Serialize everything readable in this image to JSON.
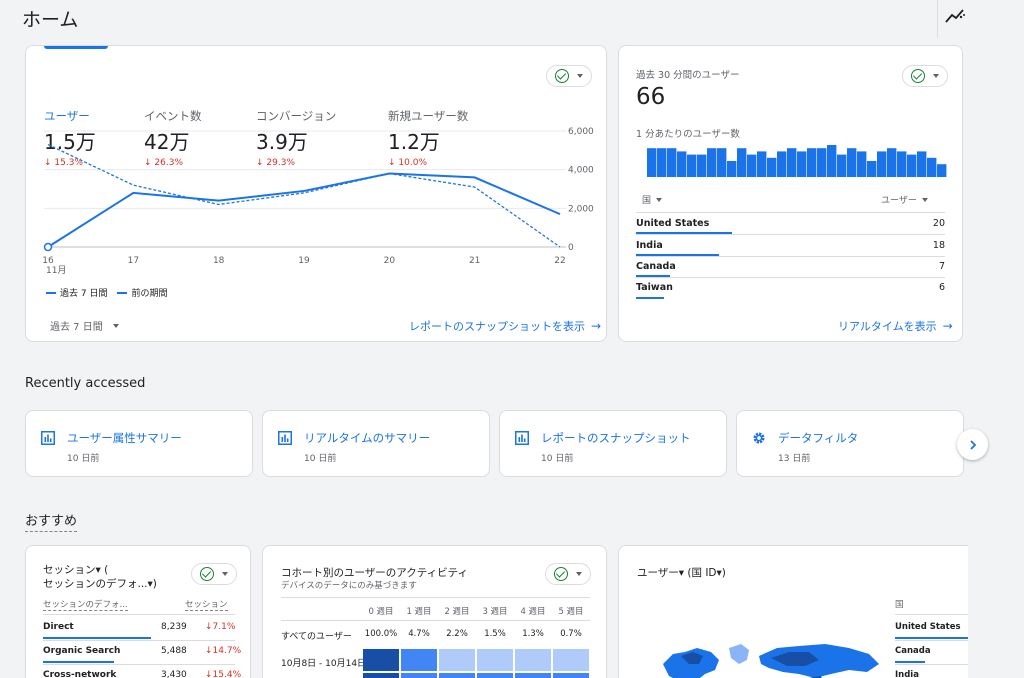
{
  "page": {
    "title": "ホーム"
  },
  "overview": {
    "metrics": [
      {
        "label": "ユーザー",
        "value": "1.5万",
        "change": "15.3%"
      },
      {
        "label": "イベント数",
        "value": "42万",
        "change": "26.3%"
      },
      {
        "label": "コンバージョン",
        "value": "3.9万",
        "change": "29.3%"
      },
      {
        "label": "新規ユーザー数",
        "value": "1.2万",
        "change": "10.0%"
      }
    ],
    "legend_current": "過去 7 日間",
    "legend_previous": "前の期間",
    "range_select": "過去 7 日間",
    "report_link": "レポートのスナップショットを表示",
    "month_label": "11月"
  },
  "chart_data": {
    "type": "line",
    "x": [
      "16",
      "17",
      "18",
      "19",
      "20",
      "21",
      "22"
    ],
    "yticks": [
      "6,000",
      "4,000",
      "2,000",
      "0"
    ],
    "ylim": [
      0,
      6000
    ],
    "series": [
      {
        "name": "過去 7 日間",
        "values": [
          0,
          2800,
          2400,
          2900,
          3800,
          3600,
          1700
        ],
        "color": "#1a73e8",
        "style": "solid"
      },
      {
        "name": "前の期間",
        "values": [
          5300,
          3200,
          2200,
          2800,
          3800,
          3100,
          0
        ],
        "color": "#1a73e8",
        "style": "dashed"
      }
    ]
  },
  "realtime": {
    "title": "過去 30 分間のユーザー",
    "value": "66",
    "per_minute_label": "1 分あたりのユーザー数",
    "bars": [
      9,
      9,
      9,
      8,
      7,
      7,
      9,
      9,
      5,
      9,
      7,
      8,
      6,
      8,
      9,
      8,
      9,
      9,
      10,
      7,
      9,
      8,
      5,
      8,
      9,
      8,
      7,
      8,
      6,
      4
    ],
    "col_country": "国",
    "col_users": "ユーザー",
    "rows": [
      {
        "country": "United States",
        "users": "20",
        "share": 0.31
      },
      {
        "country": "India",
        "users": "18",
        "share": 0.27
      },
      {
        "country": "Canada",
        "users": "7",
        "share": 0.11
      },
      {
        "country": "Taiwan",
        "users": "6",
        "share": 0.09
      }
    ],
    "link": "リアルタイムを表示"
  },
  "recent": {
    "title": "Recently accessed",
    "items": [
      {
        "label": "ユーザー属性サマリー",
        "time": "10 日前",
        "icon": "report-icon"
      },
      {
        "label": "リアルタイムのサマリー",
        "time": "10 日前",
        "icon": "report-icon"
      },
      {
        "label": "レポートのスナップショット",
        "time": "10 日前",
        "icon": "report-icon"
      },
      {
        "label": "データフィルタ",
        "time": "13 日前",
        "icon": "gear-icon"
      }
    ]
  },
  "recommend": {
    "title": "おすすめ",
    "sessions": {
      "title_line1": "セッション▾ (",
      "title_line2": "セッションのデフォ...▾)",
      "col1": "セッションのデフォ...",
      "col2": "セッション",
      "rows": [
        {
          "name": "Direct",
          "value": "8,239",
          "change": "7.1%",
          "share": 0.56
        },
        {
          "name": "Organic Search",
          "value": "5,488",
          "change": "14.7%",
          "share": 0.37
        },
        {
          "name": "Cross-network",
          "value": "3,430",
          "change": "15.4%",
          "share": 0.23
        }
      ]
    },
    "cohort": {
      "title": "コホート別のユーザーのアクティビティ",
      "subtitle": "デバイスのデータにのみ基づきます",
      "weeks": [
        "0 週目",
        "1 週目",
        "2 週目",
        "3 週目",
        "4 週目",
        "5 週目"
      ],
      "all_label": "すべてのユーザー",
      "all_values": [
        "100.0%",
        "4.7%",
        "2.2%",
        "1.5%",
        "1.3%",
        "0.7%"
      ],
      "row_label": "10月8日 - 10月14日"
    },
    "map": {
      "title": "ユーザー▾ (国 ID▾)",
      "col": "国",
      "rows": [
        "United States",
        "Canada",
        "India"
      ]
    }
  }
}
